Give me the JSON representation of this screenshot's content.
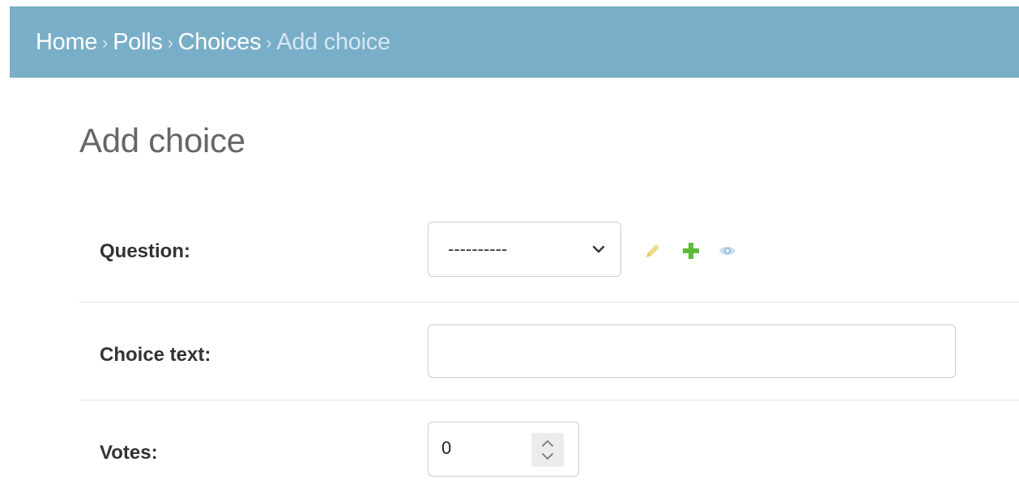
{
  "breadcrumbs": {
    "items": [
      "Home",
      "Polls",
      "Choices"
    ],
    "separator": "›",
    "current": "Add choice"
  },
  "page": {
    "title": "Add choice"
  },
  "form": {
    "question": {
      "label": "Question:",
      "selected": "----------",
      "icons": [
        "pencil-icon",
        "plus-icon",
        "eye-icon"
      ]
    },
    "choice_text": {
      "label": "Choice text:",
      "value": ""
    },
    "votes": {
      "label": "Votes:",
      "value": "0"
    }
  },
  "colors": {
    "header_bg": "#79aec8",
    "edit_icon": "#efd98c",
    "add_icon": "#5fba3a",
    "view_icon": "#b9d3e6"
  }
}
